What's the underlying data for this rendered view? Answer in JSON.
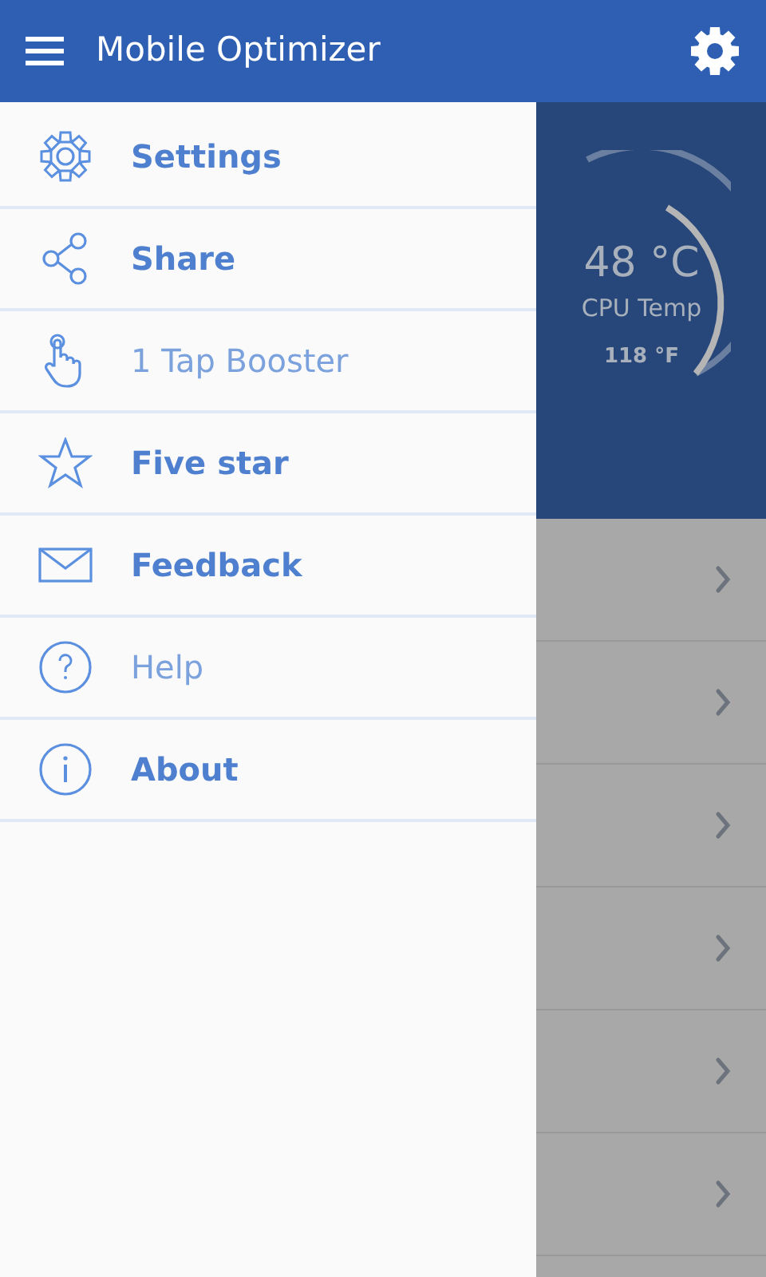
{
  "app_bar": {
    "title": "Mobile Optimizer"
  },
  "gauge": {
    "value": "48 °C",
    "label": "CPU Temp",
    "secondary": "118 °F"
  },
  "drawer": {
    "items": [
      {
        "label": "Settings",
        "kind": "gear",
        "light": false
      },
      {
        "label": "Share",
        "kind": "share",
        "light": false
      },
      {
        "label": "1 Tap Booster",
        "kind": "tap",
        "light": true
      },
      {
        "label": "Five star",
        "kind": "star",
        "light": false
      },
      {
        "label": "Feedback",
        "kind": "mail",
        "light": false
      },
      {
        "label": "Help",
        "kind": "help",
        "light": true
      },
      {
        "label": "About",
        "kind": "info",
        "light": false
      }
    ]
  }
}
